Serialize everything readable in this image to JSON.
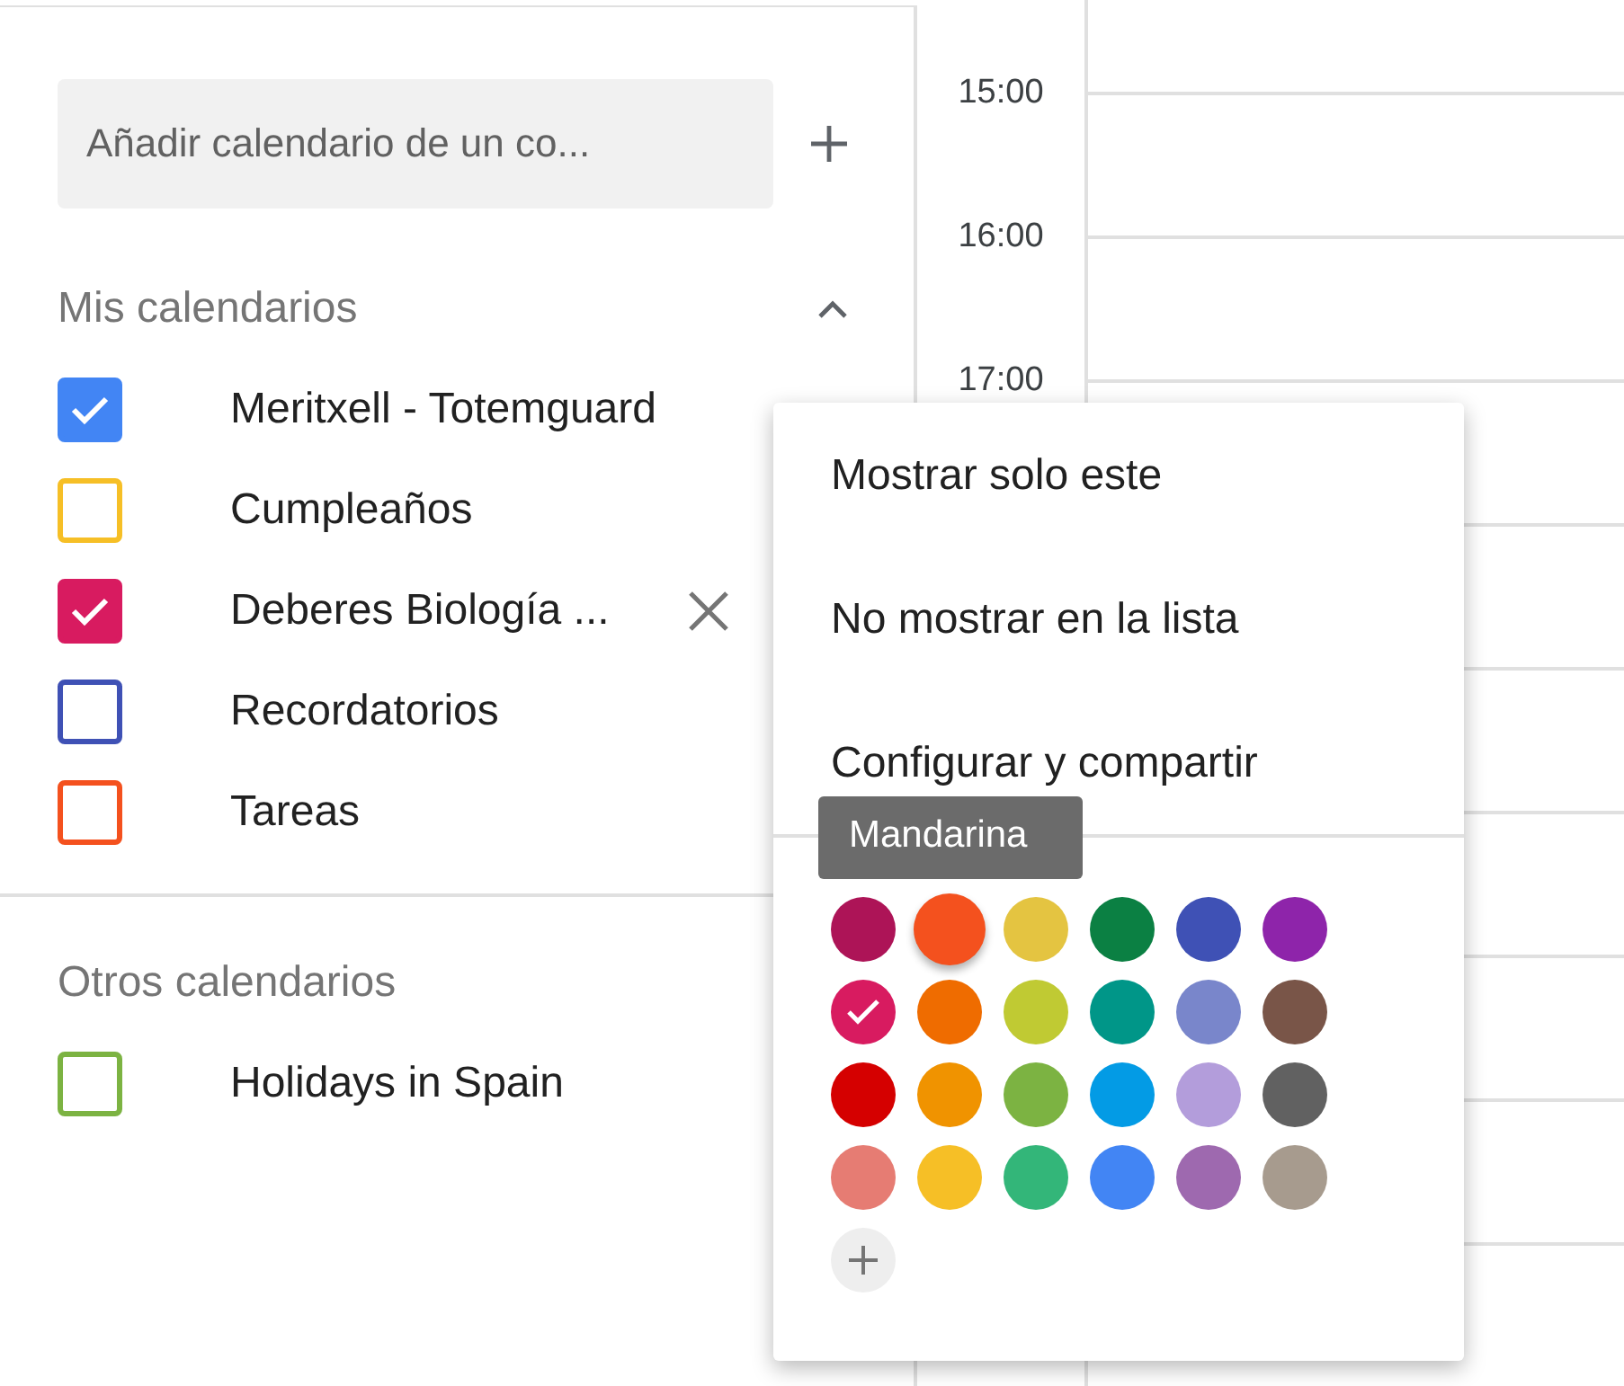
{
  "sidebar": {
    "add_calendar": {
      "placeholder": "Añadir calendario de un co..."
    },
    "my_calendars": {
      "title": "Mis calendarios",
      "expanded": true,
      "items": [
        {
          "label": "Meritxell - Totemguard",
          "checked": true,
          "color": "#4285f4",
          "hovered": false
        },
        {
          "label": "Cumpleaños",
          "checked": false,
          "color": "#f6bf26",
          "hovered": false
        },
        {
          "label": "Deberes Biología ...",
          "checked": true,
          "color": "#d81b60",
          "hovered": true
        },
        {
          "label": "Recordatorios",
          "checked": false,
          "color": "#3f51b5",
          "hovered": false
        },
        {
          "label": "Tareas",
          "checked": false,
          "color": "#f4511e",
          "hovered": false
        }
      ]
    },
    "other_calendars": {
      "title": "Otros calendarios",
      "items": [
        {
          "label": "Holidays in Spain",
          "checked": false,
          "color": "#7cb342",
          "hovered": false
        }
      ]
    }
  },
  "timeline": {
    "times": [
      "15:00",
      "16:00",
      "17:00"
    ]
  },
  "menu": {
    "items": [
      "Mostrar solo este",
      "No mostrar en la lista",
      "Configurar y compartir"
    ],
    "tooltip": "Mandarina",
    "swatches": [
      {
        "color": "#ad1457",
        "selected": false,
        "hovered": false
      },
      {
        "color": "#f4511e",
        "selected": false,
        "hovered": true
      },
      {
        "color": "#e4c441",
        "selected": false,
        "hovered": false
      },
      {
        "color": "#0b8043",
        "selected": false,
        "hovered": false
      },
      {
        "color": "#3f51b5",
        "selected": false,
        "hovered": false
      },
      {
        "color": "#8e24aa",
        "selected": false,
        "hovered": false
      },
      {
        "color": "#d81b60",
        "selected": true,
        "hovered": false
      },
      {
        "color": "#ef6c00",
        "selected": false,
        "hovered": false
      },
      {
        "color": "#c0ca33",
        "selected": false,
        "hovered": false
      },
      {
        "color": "#009688",
        "selected": false,
        "hovered": false
      },
      {
        "color": "#7986cb",
        "selected": false,
        "hovered": false
      },
      {
        "color": "#795548",
        "selected": false,
        "hovered": false
      },
      {
        "color": "#d50000",
        "selected": false,
        "hovered": false
      },
      {
        "color": "#f09300",
        "selected": false,
        "hovered": false
      },
      {
        "color": "#7cb342",
        "selected": false,
        "hovered": false
      },
      {
        "color": "#039be5",
        "selected": false,
        "hovered": false
      },
      {
        "color": "#b39ddb",
        "selected": false,
        "hovered": false
      },
      {
        "color": "#616161",
        "selected": false,
        "hovered": false
      },
      {
        "color": "#e67c73",
        "selected": false,
        "hovered": false
      },
      {
        "color": "#f6bf26",
        "selected": false,
        "hovered": false
      },
      {
        "color": "#33b679",
        "selected": false,
        "hovered": false
      },
      {
        "color": "#4285f4",
        "selected": false,
        "hovered": false
      },
      {
        "color": "#9e69af",
        "selected": false,
        "hovered": false
      },
      {
        "color": "#a79b8e",
        "selected": false,
        "hovered": false
      }
    ]
  }
}
